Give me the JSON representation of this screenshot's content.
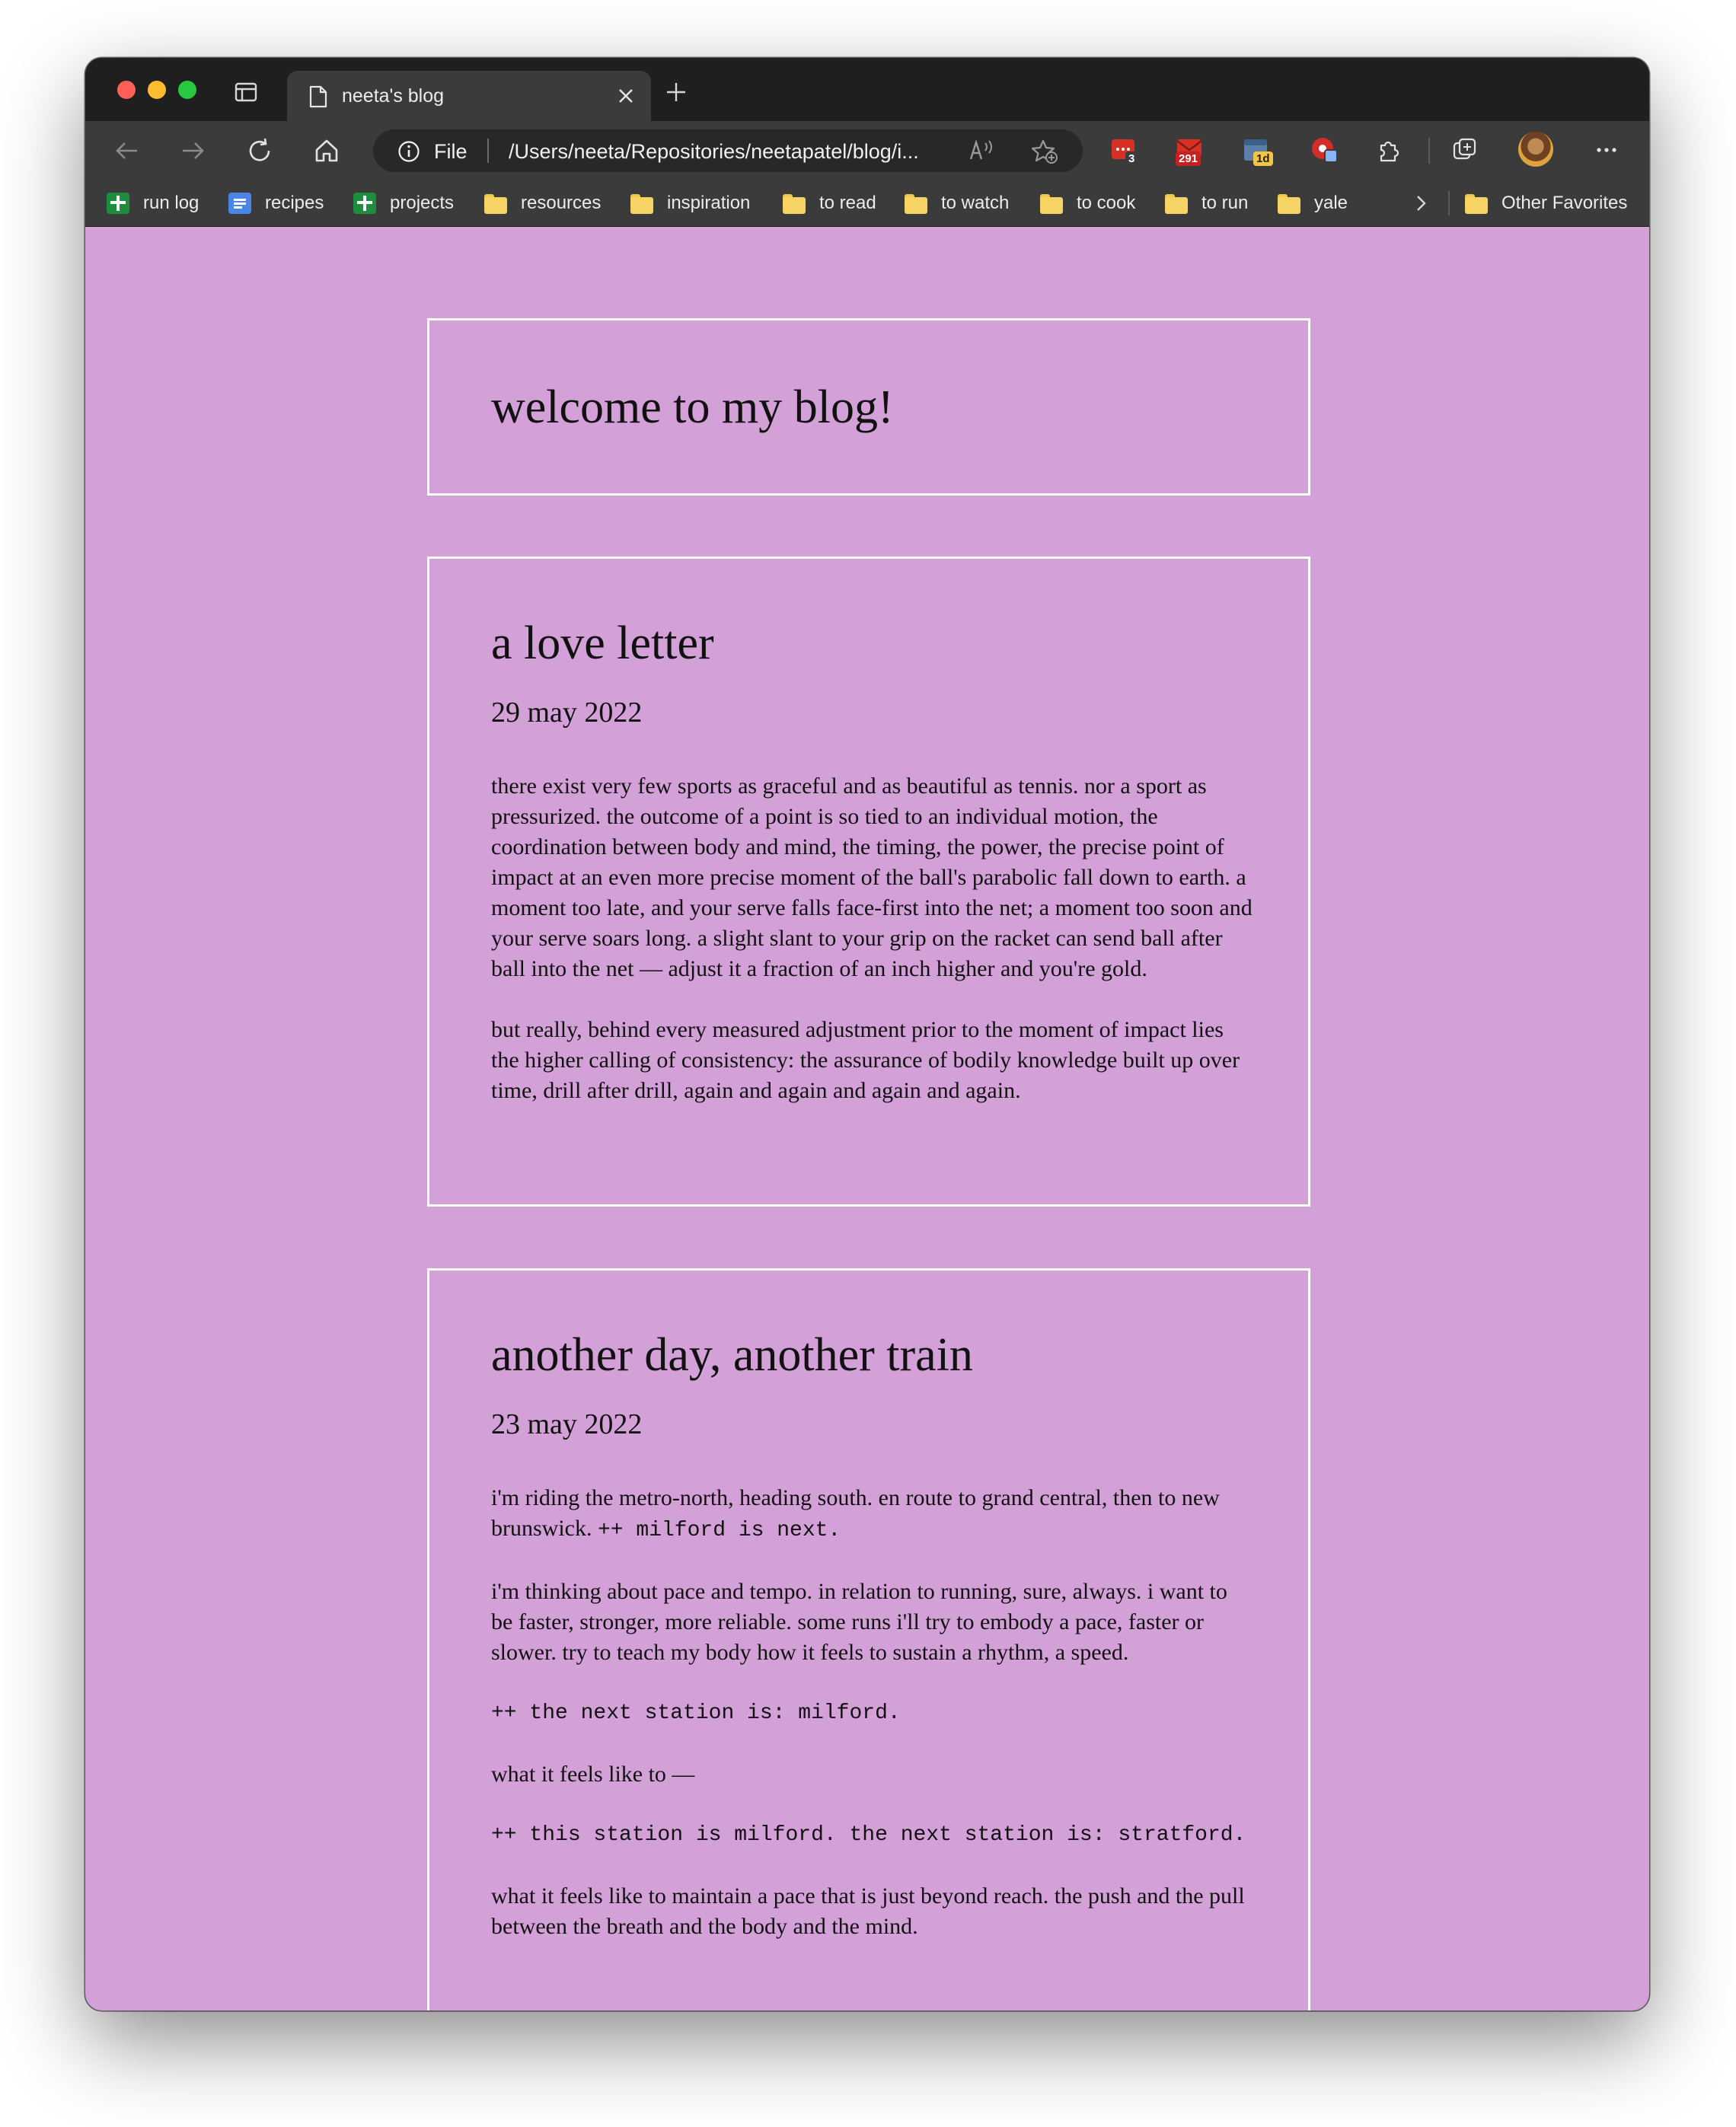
{
  "browser": {
    "tab_title": "neeta's blog",
    "address_scheme": "File",
    "address_url": "/Users/neeta/Repositories/neetapatel/blog/i...",
    "extensions": [
      {
        "name": "todoist-icon",
        "badge": "3"
      },
      {
        "name": "mail-icon",
        "badge": "291"
      },
      {
        "name": "calendar-icon",
        "badge": "1d"
      },
      {
        "name": "lastpass-icon",
        "badge": ""
      }
    ],
    "favorites": [
      {
        "label": "run log",
        "icon": "google-sheets-icon"
      },
      {
        "label": "recipes",
        "icon": "google-docs-icon"
      },
      {
        "label": "projects",
        "icon": "google-sheets-icon"
      },
      {
        "label": "resources",
        "icon": "folder-icon"
      },
      {
        "label": "inspiration",
        "icon": "folder-icon"
      },
      {
        "label": "to read",
        "icon": "folder-icon"
      },
      {
        "label": "to watch",
        "icon": "folder-icon"
      },
      {
        "label": "to cook",
        "icon": "folder-icon"
      },
      {
        "label": "to run",
        "icon": "folder-icon"
      },
      {
        "label": "yale",
        "icon": "folder-icon"
      }
    ],
    "other_favorites": "Other Favorites",
    "colors": {
      "page_background": "#d4a0d8",
      "card_border": "#ffffff"
    }
  },
  "blog": {
    "header": "welcome to my blog!",
    "posts": [
      {
        "title": "a love letter",
        "date": "29 may 2022",
        "paragraphs": [
          "there exist very few sports as graceful and as beautiful as tennis. nor a sport as pressurized. the outcome of a point is so tied to an individual motion, the coordination between body and mind, the timing, the power, the precise point of impact at an even more precise moment of the ball's parabolic fall down to earth. a moment too late, and your serve falls face-first into the net; a moment too soon and your serve soars long. a slight slant to your grip on the racket can send ball after ball into the net — adjust it a fraction of an inch higher and you're gold.",
          "but really, behind every measured adjustment prior to the moment of impact lies the higher calling of consistency: the assurance of bodily knowledge built up over time, drill after drill, again and again and again and again."
        ]
      },
      {
        "title": "another day, another train",
        "date": "23 may 2022",
        "p1_text": "i'm riding the metro-north, heading south. en route to grand central, then to new brunswick.",
        "p1_mono": "++ milford is next.",
        "p2": "i'm thinking about pace and tempo. in relation to running, sure, always. i want to be faster, stronger, more reliable. some runs i'll try to embody a pace, faster or slower. try to teach my body how it feels to sustain a rhythm, a speed.",
        "p3_mono": "++ the next station is: milford.",
        "p4": "what it feels like to —",
        "p5_mono": "++ this station is milford. the next station is: stratford.",
        "p6": "what it feels like to maintain a pace that is just beyond reach. the push and the pull between the breath and the body and the mind."
      }
    ]
  }
}
